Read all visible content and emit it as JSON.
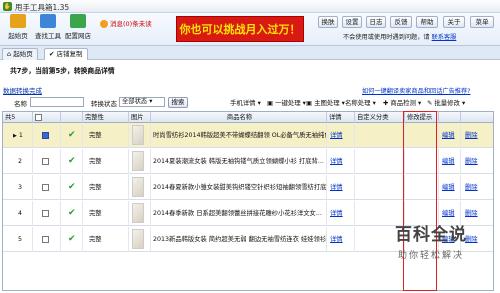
{
  "title_bar": {
    "title": "甩手工具箱1.35"
  },
  "toolbar": {
    "launch": "起始页",
    "find_tools": "查找工具",
    "config_shop": "配置网店",
    "message": "消息(0)条未读",
    "banner": "你也可以挑战月入过万！",
    "buttons": [
      "换肤",
      "设置",
      "日志",
      "反馈",
      "帮助",
      "关于",
      "菜单"
    ],
    "notice_text": "不会使用或使用时遇到问题，请",
    "notice_link": "联系客服"
  },
  "tabs": [
    {
      "label": "起始页"
    },
    {
      "label": "店铺复制"
    }
  ],
  "steps": "共7步，当前第5步，转换商品详情",
  "subtitle": "数据转换完成",
  "filter": {
    "name_label": "名称",
    "status_label": "转换状态",
    "status_value": "全部状态",
    "search": "搜索",
    "actions": [
      "手机详情",
      "一键处理",
      "主图处理",
      "名称处理",
      "商品检测",
      "批量修改"
    ],
    "help_link": "如何一键翻译卖家商品和回话广告推荐?"
  },
  "grid": {
    "headers": [
      "共5",
      "",
      "",
      "完整性",
      "图片",
      "商品名称",
      "详情",
      "自定义分类",
      "修改提示",
      "",
      ""
    ],
    "rows": [
      {
        "num": "1",
        "checked": true,
        "status": "完整",
        "name": "时尚雪纺衫2014韩版超美不带蝴蝶结翻领 OL必备气质无袖纯色...",
        "detail": "详情",
        "edit": "编辑",
        "del": "删除"
      },
      {
        "num": "2",
        "checked": false,
        "status": "完整",
        "name": "2014夏装潮流女装 韩版无袖钩镂气质立领蝴蝶小衫 打底背...",
        "detail": "详情",
        "edit": "编辑",
        "del": "删除"
      },
      {
        "num": "3",
        "checked": false,
        "status": "完整",
        "name": "2014春夏新款小雏女装甜美钩织镂空针织衫短袖翻领雪纺打底...",
        "detail": "详情",
        "edit": "编辑",
        "del": "删除"
      },
      {
        "num": "4",
        "checked": false,
        "status": "完整",
        "name": "2014春季新款 日系超美翻领蕾丝拼接花雕纱小花衫洋文女...",
        "detail": "详情",
        "edit": "编辑",
        "del": "删除"
      },
      {
        "num": "5",
        "checked": false,
        "status": "完整",
        "name": "2013新品韩版女装 简约超美无弱 翻边无袖雪纺连衣 娃娃领衫...",
        "detail": "详情",
        "edit": "编辑",
        "del": "删除"
      }
    ]
  },
  "watermark": {
    "main": "百科全说",
    "sub": "助你轻松解决"
  },
  "colors": {
    "banner_bg": "#d81a12",
    "banner_text": "#ffe600",
    "link": "#0033cc",
    "selected_row": "#f6f0c6",
    "highlight_box": "#e02020"
  }
}
